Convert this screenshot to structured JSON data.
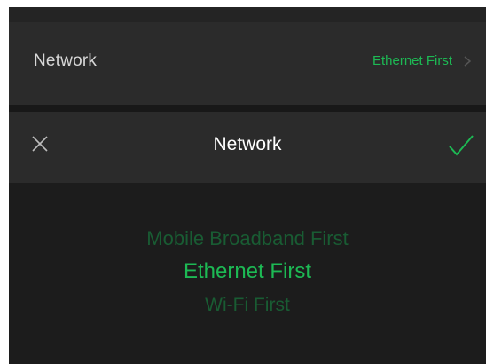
{
  "settings_row": {
    "label": "Network",
    "value": "Ethernet First",
    "chevron_icon": "chevron-right-icon"
  },
  "picker": {
    "title": "Network",
    "close_icon": "close-icon",
    "confirm_icon": "checkmark-icon",
    "options": [
      "Mobile Broadband First",
      "Ethernet First",
      "Wi-Fi First"
    ],
    "selected": "Ethernet First"
  },
  "colors": {
    "accent": "#1db954",
    "accent_dim": "#195c33",
    "background": "#1c1c1c",
    "surface": "#2b2b2b",
    "text_primary": "#ffffff",
    "text_secondary": "#d7d7d7"
  }
}
